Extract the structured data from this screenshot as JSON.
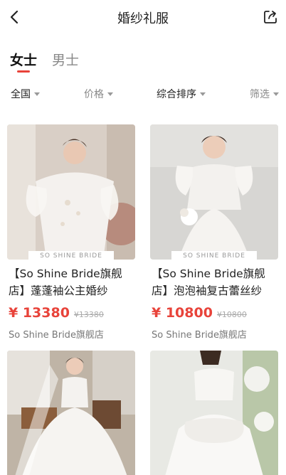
{
  "header": {
    "title": "婚纱礼服"
  },
  "tabs": [
    {
      "label": "女士",
      "active": true
    },
    {
      "label": "男士",
      "active": false
    }
  ],
  "filters": {
    "region": "全国",
    "price": "价格",
    "sort": "综合排序",
    "filter": "筛选"
  },
  "products": [
    {
      "title": "【So Shine Bride旗舰店】蓬蓬袖公主婚纱",
      "price": "¥ 13380",
      "original_price": "¥13380",
      "shop": "So Shine Bride旗舰店",
      "watermark": "SO SHINE BRIDE"
    },
    {
      "title": "【So Shine Bride旗舰店】泡泡袖复古蕾丝纱",
      "price": "¥ 10800",
      "original_price": "¥10800",
      "shop": "So Shine Bride旗舰店",
      "watermark": "SO SHINE BRIDE"
    },
    {
      "title": "",
      "price": "",
      "original_price": "",
      "shop": ""
    },
    {
      "title": "",
      "price": "",
      "original_price": "",
      "shop": ""
    }
  ],
  "colors": {
    "accent": "#e8433a",
    "text": "#222222",
    "muted": "#888888"
  },
  "icons": {
    "back": "chevron-left-icon",
    "share": "share-icon",
    "dropdown": "caret-down-icon"
  }
}
